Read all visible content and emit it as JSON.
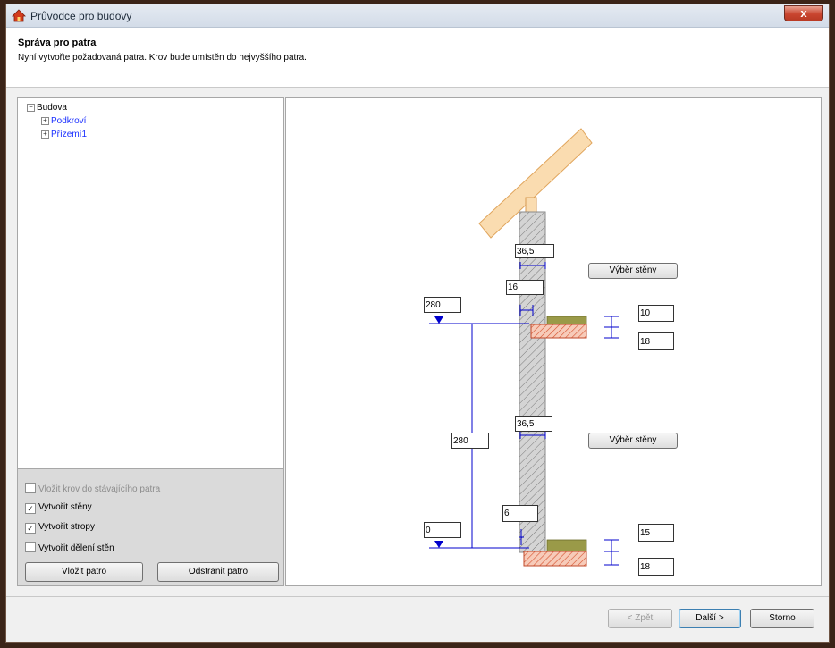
{
  "window": {
    "title": "Průvodce pro budovy",
    "close_label": "x"
  },
  "header": {
    "title": "Správa pro patra",
    "subtitle": "Nyní vytvořte požadovaná patra. Krov bude umístěn do nejvyššího patra."
  },
  "tree": {
    "root": "Budova",
    "children": [
      "Podkroví",
      "Přízemí1"
    ]
  },
  "options": {
    "insert_roof": "Vložit krov do stávajícího patra",
    "create_walls": "Vytvořit stěny",
    "create_ceilings": "Vytvořit stropy",
    "create_wall_division": "Vytvořit dělení stěn",
    "checked": {
      "insert_roof": false,
      "create_walls": true,
      "create_ceilings": true,
      "create_wall_division": false
    },
    "insert_floor_button": "Vložit patro",
    "remove_floor_button": "Odstranit patro"
  },
  "drawing": {
    "upper_wall_thickness": "36,5",
    "upper_insulation": "16",
    "upper_wall_select_button": "Výběr stěny",
    "upper_floor_elevation": "280",
    "upper_slab_top": "10",
    "upper_slab_bottom": "18",
    "lower_wall_thickness": "36,5",
    "lower_wall_select_button": "Výběr stěny",
    "floor_height": "280",
    "lower_insulation": "6",
    "lower_floor_elevation": "0",
    "lower_slab_top": "15",
    "lower_slab_bottom": "18"
  },
  "footer": {
    "back": "< Zpět",
    "next": "Další >",
    "cancel": "Storno"
  },
  "colors": {
    "dimension_blue": "#0000cc",
    "roof": "#fad9a6",
    "slab_hatch": "#e07050",
    "screed": "#9a9a48",
    "wall_hatch": "#c8c8c8"
  }
}
